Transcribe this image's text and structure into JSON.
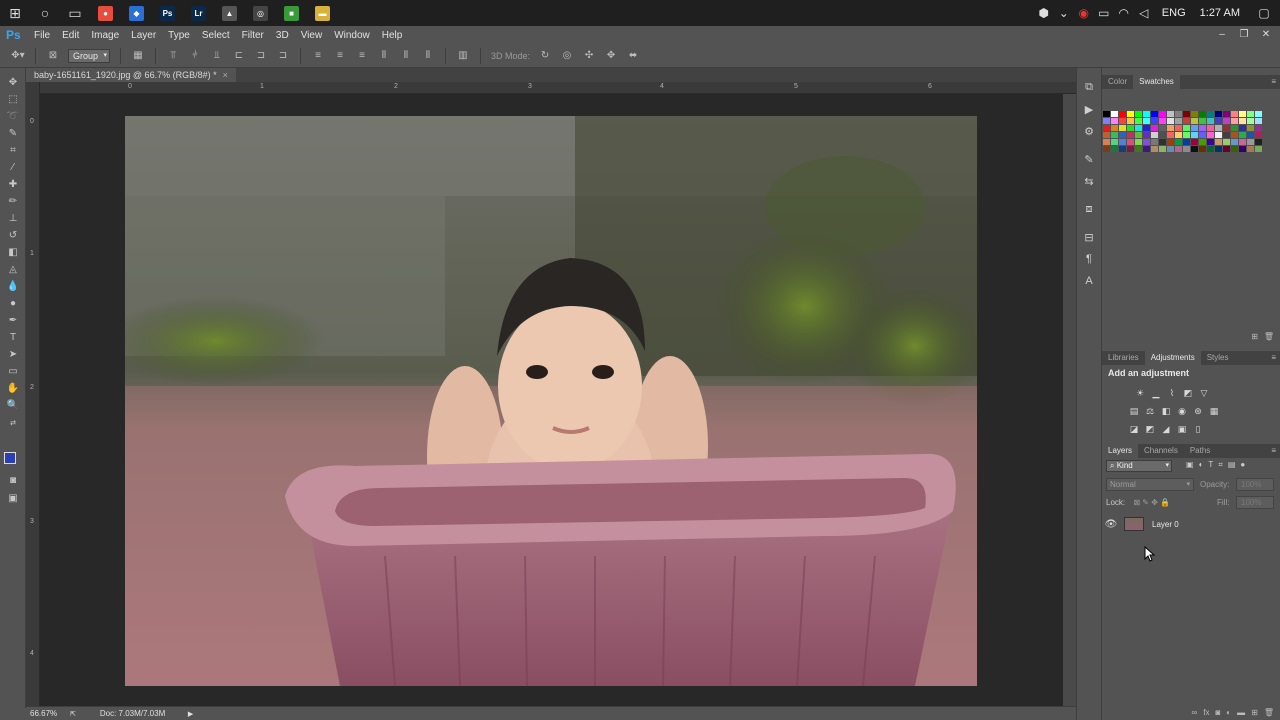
{
  "taskbar": {
    "apps": [
      {
        "name": "chrome",
        "color": "#e74c3c",
        "glyph": "●"
      },
      {
        "name": "app-blue",
        "color": "#2a6fd6",
        "glyph": "◆"
      },
      {
        "name": "photoshop",
        "color": "#0b2a4a",
        "glyph": "Ps"
      },
      {
        "name": "lightroom",
        "color": "#0b2a4a",
        "glyph": "Lr"
      },
      {
        "name": "app-triangle",
        "color": "#555555",
        "glyph": "▲"
      },
      {
        "name": "app-circle",
        "color": "#444444",
        "glyph": "◎"
      },
      {
        "name": "app-green",
        "color": "#3a9a3a",
        "glyph": "■"
      },
      {
        "name": "file-explorer",
        "color": "#d9b23c",
        "glyph": "▬"
      }
    ],
    "language": "ENG",
    "time": "1:27 AM"
  },
  "app": {
    "logo": "Ps",
    "menu": [
      "File",
      "Edit",
      "Image",
      "Layer",
      "Type",
      "Select",
      "Filter",
      "3D",
      "View",
      "Window",
      "Help"
    ]
  },
  "options_bar": {
    "auto_select_value": "Group",
    "mode_3d_label": "3D Mode:"
  },
  "document": {
    "tab_title": "baby-1651161_1920.jpg @ 66.7% (RGB/8#) *",
    "ruler_top_labels": [
      "0",
      "1",
      "2",
      "3",
      "4",
      "5",
      "6"
    ],
    "ruler_left_labels": [
      "0",
      "1",
      "2",
      "3",
      "4"
    ]
  },
  "status": {
    "zoom": "66.67%",
    "doc_info": "Doc: 7.03M/7.03M"
  },
  "panels": {
    "color_tabs": [
      "Color",
      "Swatches"
    ],
    "adjust_tabs": [
      "Libraries",
      "Adjustments",
      "Styles"
    ],
    "add_adjustment": "Add an adjustment",
    "layers_tabs": [
      "Layers",
      "Channels",
      "Paths"
    ],
    "filter_kind": "Kind",
    "blend_mode": "Normal",
    "opacity_label": "Opacity:",
    "opacity_value": "100%",
    "lock_label": "Lock:",
    "fill_label": "Fill:",
    "fill_value": "100%",
    "layer_name": "Layer 0"
  },
  "swatch_colors": [
    "#000000",
    "#ffffff",
    "#ff0000",
    "#ffff00",
    "#00ff00",
    "#00ffff",
    "#0000ff",
    "#ff00ff",
    "#c0c0c0",
    "#808080",
    "#800000",
    "#808000",
    "#008000",
    "#008080",
    "#000080",
    "#800080",
    "#ff8080",
    "#ffff80",
    "#80ff80",
    "#80ffff",
    "#8080ff",
    "#ff80ff",
    "#ff4040",
    "#ffc040",
    "#40ff40",
    "#40ffff",
    "#4040ff",
    "#ff40ff",
    "#e0e0e0",
    "#a0a0a0",
    "#c04040",
    "#c0c040",
    "#40c040",
    "#40c0c0",
    "#4040c0",
    "#c040c0",
    "#ffa0a0",
    "#ffe0a0",
    "#a0ffa0",
    "#a0e0ff",
    "#e02020",
    "#e08020",
    "#e0e020",
    "#20e020",
    "#20e0e0",
    "#2020e0",
    "#e020e0",
    "#606060",
    "#f0a060",
    "#f06060",
    "#60f060",
    "#60a0f0",
    "#a060f0",
    "#f060a0",
    "#b0b0b0",
    "#903030",
    "#309030",
    "#303090",
    "#909030",
    "#903090",
    "#c06030",
    "#30c060",
    "#3060c0",
    "#c03060",
    "#60c030",
    "#6030c0",
    "#d0d0d0",
    "#505050",
    "#ff6060",
    "#ffd060",
    "#60ff60",
    "#60d0ff",
    "#6060ff",
    "#ff60d0",
    "#f0f0f0",
    "#404040",
    "#b05020",
    "#20b050",
    "#2050b0",
    "#b02050",
    "#d88050",
    "#50d880",
    "#5080d8",
    "#d85080",
    "#80d850",
    "#8050d8",
    "#787878",
    "#303030",
    "#a04000",
    "#00a040",
    "#0040a0",
    "#a00040",
    "#40a000",
    "#4000a0",
    "#cc9966",
    "#99cc66",
    "#6699cc",
    "#cc6699",
    "#999999",
    "#202020",
    "#7a3d1a",
    "#1a7a3d",
    "#1a3d7a",
    "#7a1a3d",
    "#3d7a1a",
    "#3d1a7a",
    "#b38c66",
    "#8cb366",
    "#668cb3",
    "#b3668c",
    "#8c8c8c",
    "#101010",
    "#663300",
    "#006633",
    "#003366",
    "#660033",
    "#336600",
    "#330066",
    "#aa7755",
    "#77aa55"
  ]
}
